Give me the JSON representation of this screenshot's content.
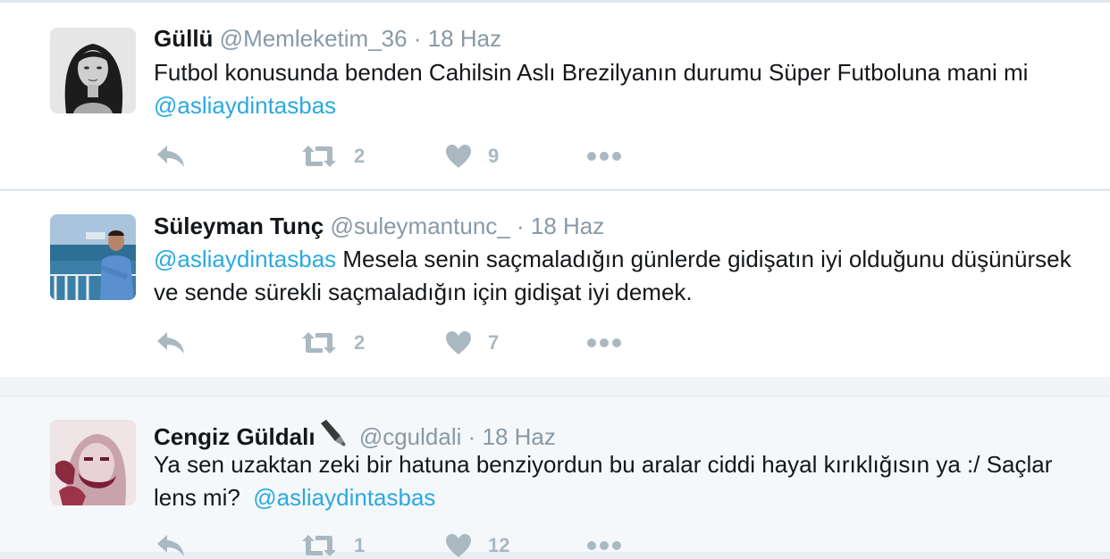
{
  "colors": {
    "mention": "#2aa9e0",
    "secondary_text": "#8899a6",
    "action_icon": "#aab8c2",
    "background": "#e9eef2"
  },
  "tweets": [
    {
      "name": "Güllü",
      "handle": "@Memleketim_36",
      "separator": "·",
      "date": "18 Haz",
      "text_before": "Futbol konusunda benden Cahilsin Aslı Brezilyanın durumu Süper Futboluna mani mi ",
      "mention": "@asliaydintasbas",
      "text_after": "",
      "retweets": "2",
      "likes": "9"
    },
    {
      "name": "Süleyman Tunç",
      "handle": "@suleymantunc_",
      "separator": "·",
      "date": "18 Haz",
      "mention": "@asliaydintasbas",
      "text_after": " Mesela senin saçmaladığın günlerde gidişatın iyi olduğunu düşünürsek ve sende sürekli saçmaladığın için gidişat iyi demek.",
      "retweets": "2",
      "likes": "7"
    },
    {
      "name": "Cengiz Güldalı",
      "name_emoji": "fountain-pen-icon",
      "handle": "@cguldali",
      "separator": "·",
      "date": "18 Haz",
      "text_before": "Ya sen uzaktan zeki bir hatuna benziyordun bu aralar ciddi hayal kırıklığısın ya :/ Saçlar lens mi?  ",
      "mention": "@asliaydintasbas",
      "retweets": "1",
      "likes": "12"
    }
  ],
  "icons": [
    "reply-icon",
    "retweet-icon",
    "like-icon",
    "more-icon"
  ]
}
